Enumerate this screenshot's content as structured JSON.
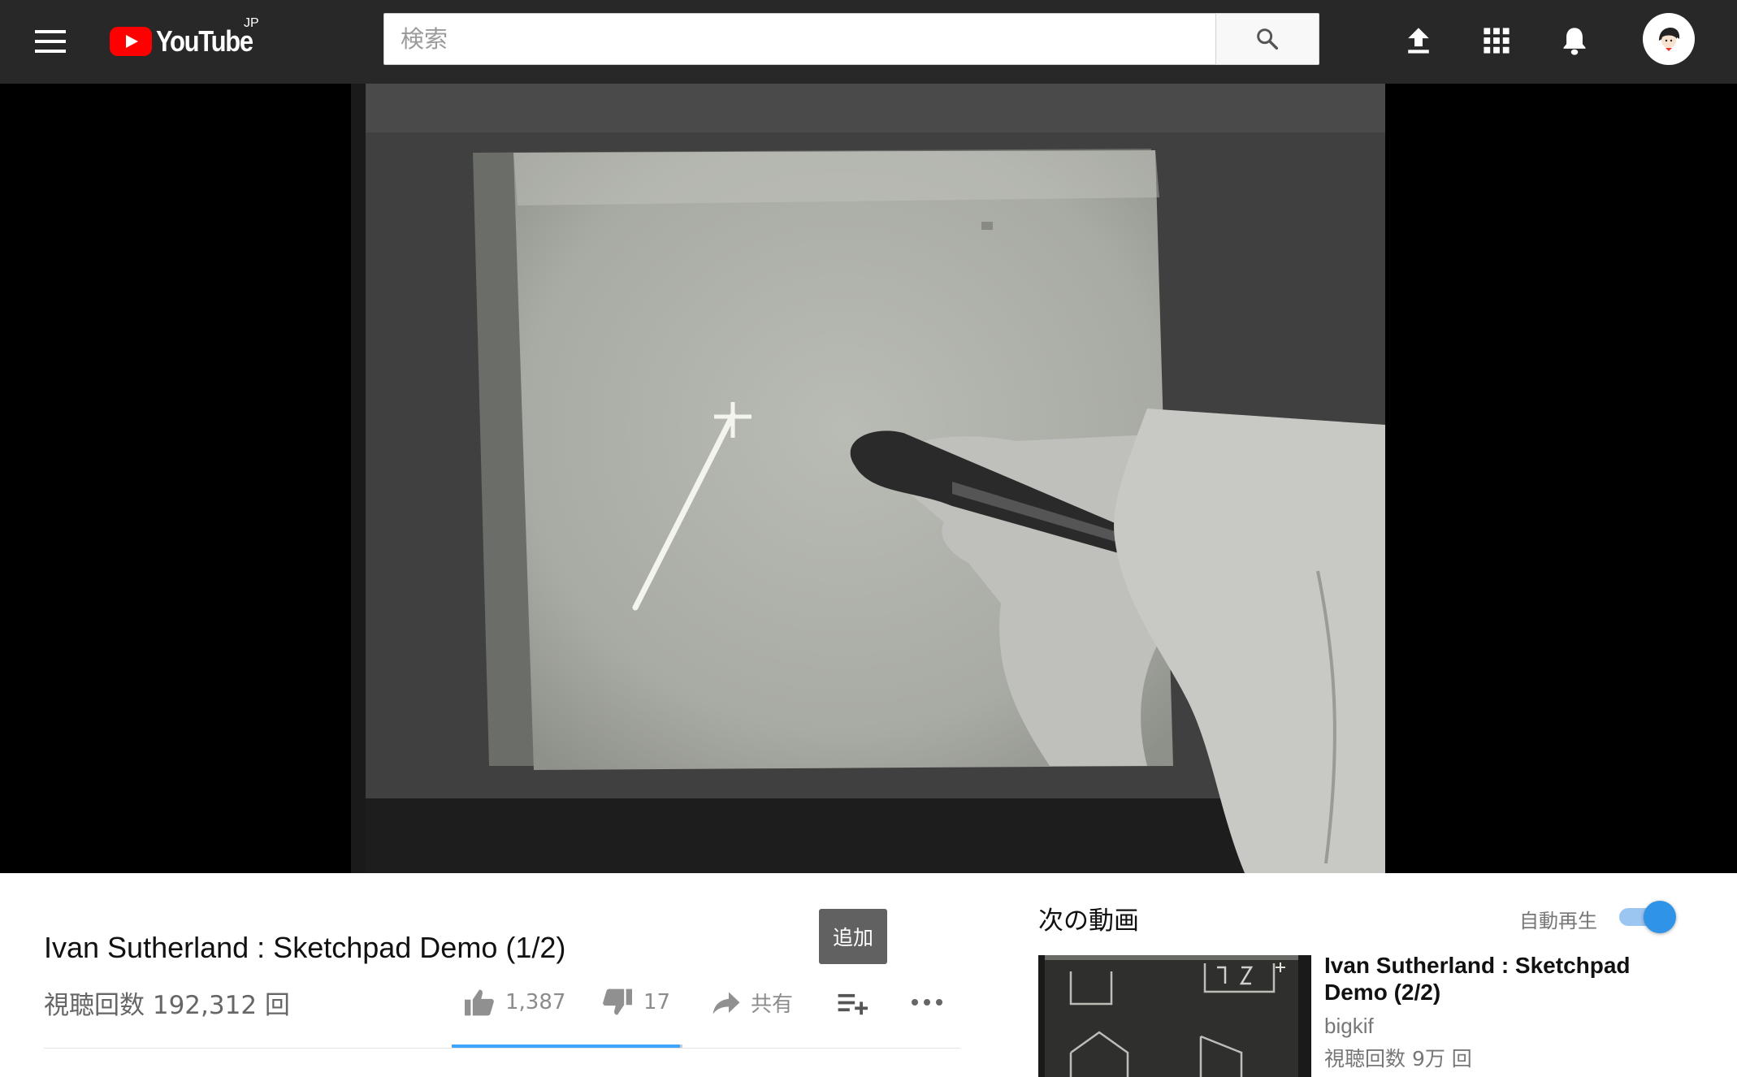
{
  "app": {
    "logo_text": "YouTube",
    "region": "JP"
  },
  "search": {
    "placeholder": "検索"
  },
  "header_icons": [
    "menu-icon",
    "upload-icon",
    "apps-grid-icon",
    "notifications-bell-icon",
    "account-avatar"
  ],
  "video": {
    "title": "Ivan Sutherland : Sketchpad Demo (1/2)",
    "views": "視聴回数 192,312 回",
    "likes": "1,387",
    "dislikes": "17",
    "share_label": "共有",
    "like_ratio": 0.988
  },
  "tooltip": {
    "add_label": "追加"
  },
  "up_next": {
    "heading": "次の動画",
    "autoplay_label": "自動再生",
    "autoplay_on": true,
    "item": {
      "title": "Ivan Sutherland : Sketchpad Demo (2/2)",
      "channel": "bigkif",
      "views": "視聴回数 9万 回"
    }
  },
  "colors": {
    "header_bg": "#282828",
    "logo_red": "#ff0000",
    "accent_blue": "#3ea6ff",
    "toggle_blue": "#2f93e8"
  }
}
